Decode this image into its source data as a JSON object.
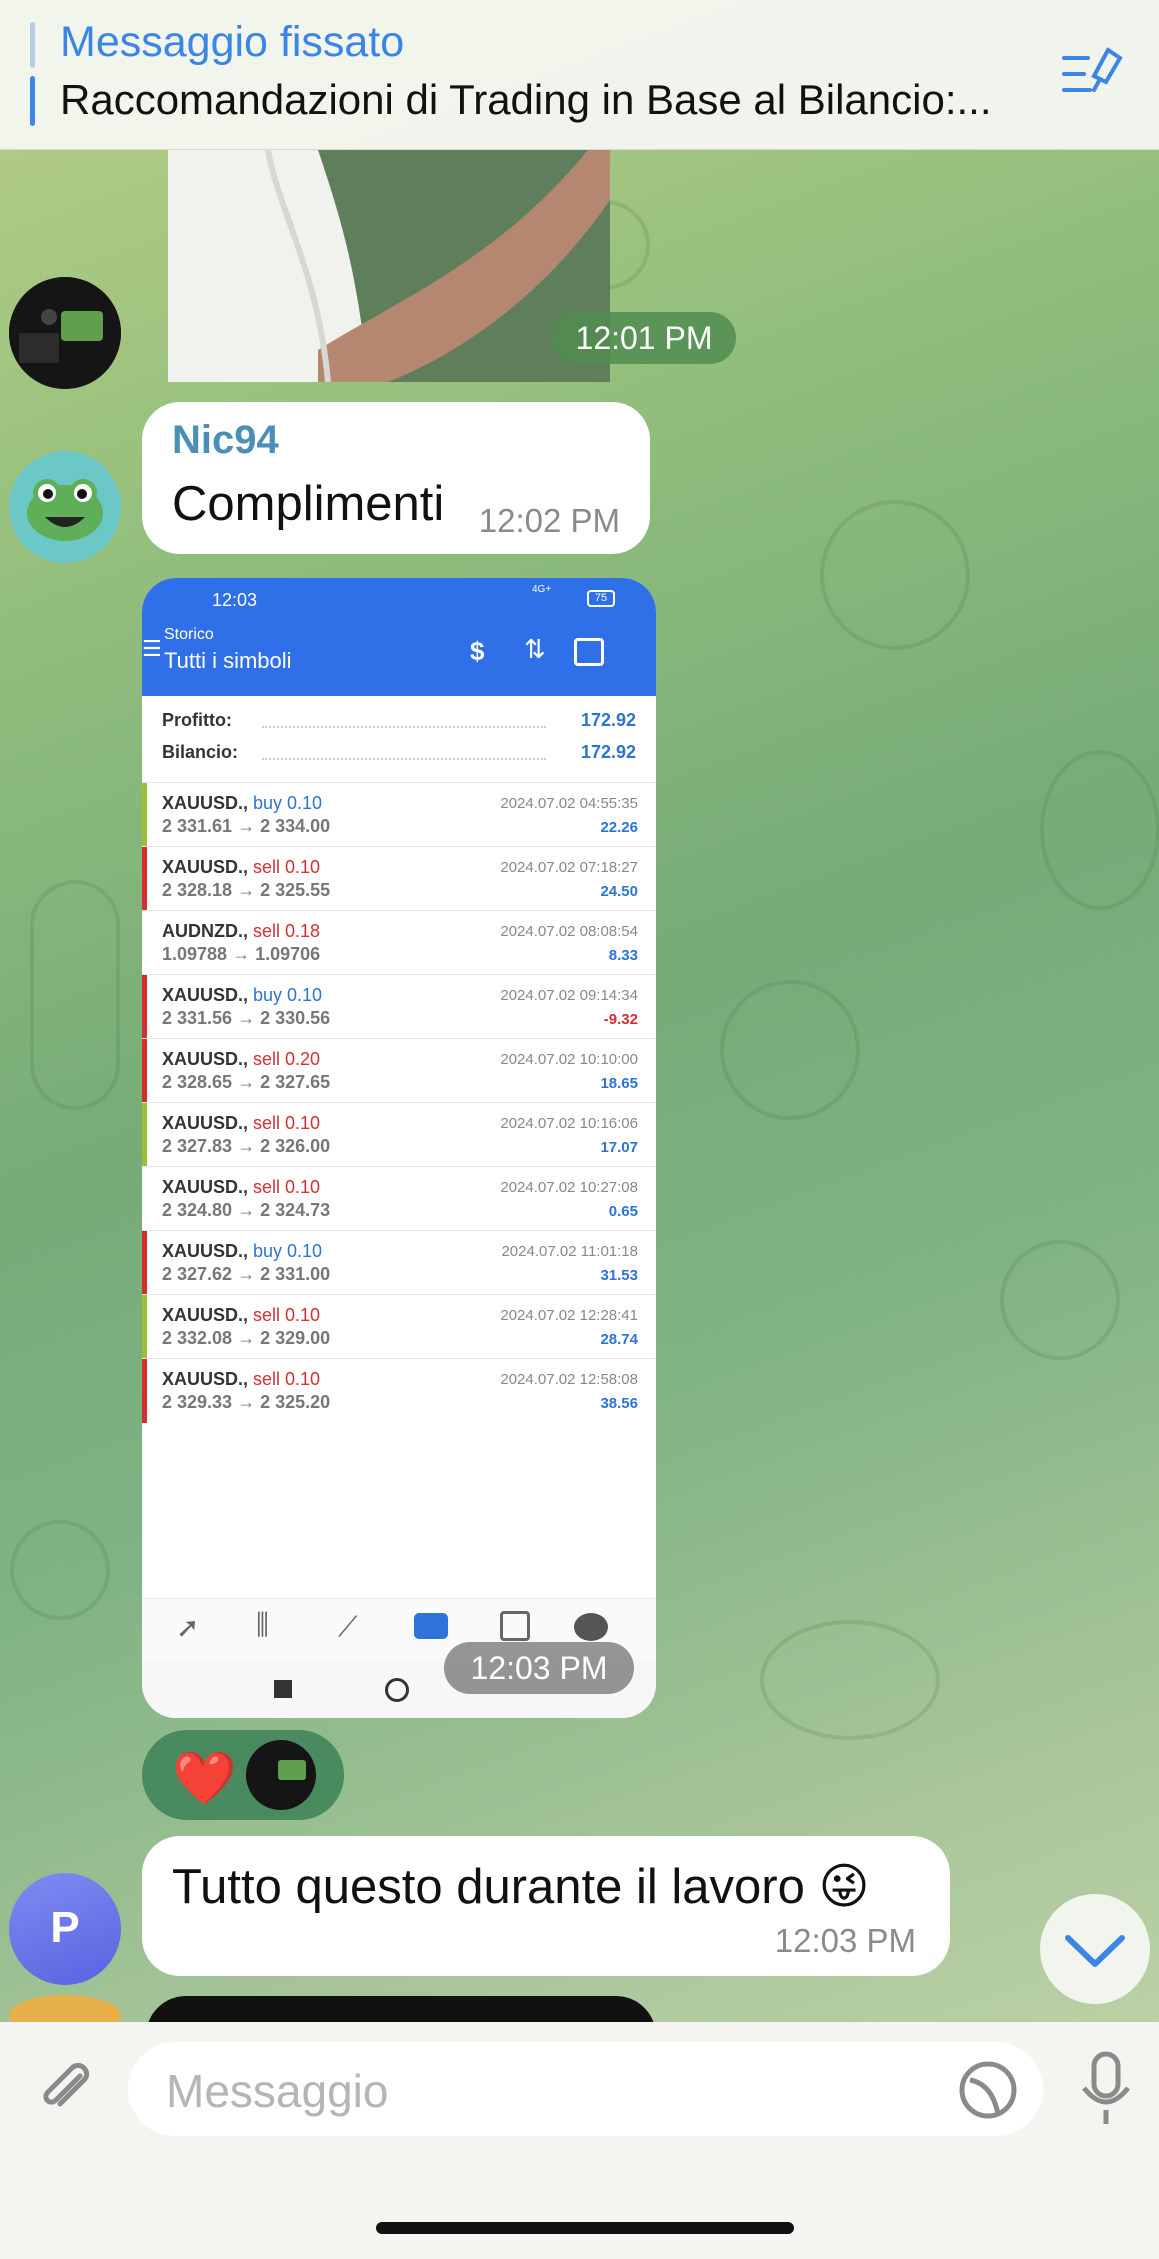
{
  "pinned": {
    "title": "Messaggio fissato",
    "text": "Raccomandazioni di Trading in Base al Bilancio:..."
  },
  "messages": {
    "photo_time": "12:01 PM",
    "nic": {
      "author": "Nic94",
      "text": "Complimenti",
      "time": "12:02 PM"
    },
    "screenshot_time": "12:03 PM",
    "tutto": {
      "text": "Tutto questo durante il lavoro 😜",
      "time": "12:03 PM"
    },
    "reaction_emoji": "❤️",
    "avatar_letter": "P"
  },
  "screenshot": {
    "status_time": "12:03",
    "status_net": "4G+",
    "battery": "75",
    "appbar_sub": "Storico",
    "appbar_title": "Tutti i simboli",
    "profit_label": "Profitto:",
    "profit_value": "172.92",
    "balance_label": "Bilancio:",
    "balance_value": "172.92",
    "trades": [
      {
        "symbol": "XAUUSD.,",
        "side": "buy 0.10",
        "prices": "2 331.61 → 2 334.00",
        "date": "2024.07.02 04:55:35",
        "pl": "22.26"
      },
      {
        "symbol": "XAUUSD.,",
        "side": "sell 0.10",
        "prices": "2 328.18 → 2 325.55",
        "date": "2024.07.02 07:18:27",
        "pl": "24.50"
      },
      {
        "symbol": "AUDNZD.,",
        "side": "sell 0.18",
        "prices": "1.09788 → 1.09706",
        "date": "2024.07.02 08:08:54",
        "pl": "8.33"
      },
      {
        "symbol": "XAUUSD.,",
        "side": "buy 0.10",
        "prices": "2 331.56 → 2 330.56",
        "date": "2024.07.02 09:14:34",
        "pl": "-9.32"
      },
      {
        "symbol": "XAUUSD.,",
        "side": "sell 0.20",
        "prices": "2 328.65 → 2 327.65",
        "date": "2024.07.02 10:10:00",
        "pl": "18.65"
      },
      {
        "symbol": "XAUUSD.,",
        "side": "sell 0.10",
        "prices": "2 327.83 → 2 326.00",
        "date": "2024.07.02 10:16:06",
        "pl": "17.07"
      },
      {
        "symbol": "XAUUSD.,",
        "side": "sell 0.10",
        "prices": "2 324.80 → 2 324.73",
        "date": "2024.07.02 10:27:08",
        "pl": "0.65"
      },
      {
        "symbol": "XAUUSD.,",
        "side": "buy 0.10",
        "prices": "2 327.62 → 2 331.00",
        "date": "2024.07.02 11:01:18",
        "pl": "31.53"
      },
      {
        "symbol": "XAUUSD.,",
        "side": "sell 0.10",
        "prices": "2 332.08 → 2 329.00",
        "date": "2024.07.02 12:28:41",
        "pl": "28.74"
      },
      {
        "symbol": "XAUUSD.,",
        "side": "sell 0.10",
        "prices": "2 329.33 → 2 325.20",
        "date": "2024.07.02 12:58:08",
        "pl": "38.56"
      }
    ]
  },
  "input": {
    "placeholder": "Messaggio"
  },
  "colors": {
    "accent": "#3a85e6",
    "buy": "#2f72d8",
    "sell": "#d23030",
    "positive": "#2f72d8",
    "negative": "#d23030"
  }
}
